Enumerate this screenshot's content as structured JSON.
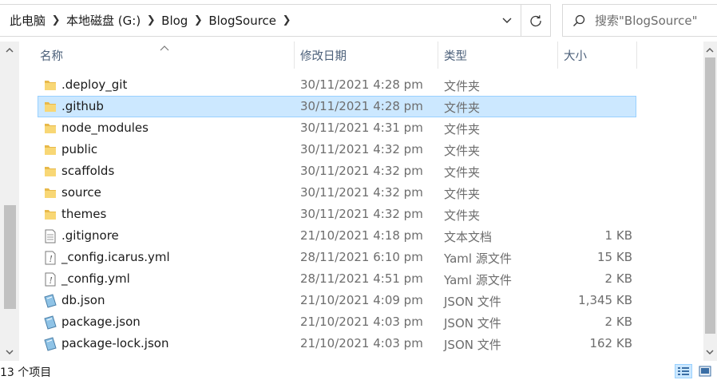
{
  "address_bar": {
    "crumbs": [
      "此电脑",
      "本地磁盘 (G:)",
      "Blog",
      "BlogSource"
    ]
  },
  "search": {
    "placeholder": "搜索\"BlogSource\""
  },
  "columns": {
    "name": "名称",
    "modified": "修改日期",
    "type": "类型",
    "size": "大小"
  },
  "files": [
    {
      "name": ".deploy_git",
      "date": "30/11/2021 4:28 pm",
      "type": "文件夹",
      "size": "",
      "icon": "folder-icon"
    },
    {
      "name": ".github",
      "date": "30/11/2021 4:28 pm",
      "type": "文件夹",
      "size": "",
      "icon": "folder-icon",
      "selected": true
    },
    {
      "name": "node_modules",
      "date": "30/11/2021 4:31 pm",
      "type": "文件夹",
      "size": "",
      "icon": "folder-icon"
    },
    {
      "name": "public",
      "date": "30/11/2021 4:32 pm",
      "type": "文件夹",
      "size": "",
      "icon": "folder-icon"
    },
    {
      "name": "scaffolds",
      "date": "30/11/2021 4:32 pm",
      "type": "文件夹",
      "size": "",
      "icon": "folder-icon"
    },
    {
      "name": "source",
      "date": "30/11/2021 4:32 pm",
      "type": "文件夹",
      "size": "",
      "icon": "folder-icon"
    },
    {
      "name": "themes",
      "date": "30/11/2021 4:32 pm",
      "type": "文件夹",
      "size": "",
      "icon": "folder-icon"
    },
    {
      "name": ".gitignore",
      "date": "21/10/2021 4:18 pm",
      "type": "文本文档",
      "size": "1 KB",
      "icon": "text-file-icon"
    },
    {
      "name": "_config.icarus.yml",
      "date": "28/11/2021 6:10 pm",
      "type": "Yaml 源文件",
      "size": "15 KB",
      "icon": "yaml-file-icon"
    },
    {
      "name": "_config.yml",
      "date": "28/11/2021 4:51 pm",
      "type": "Yaml 源文件",
      "size": "2 KB",
      "icon": "yaml-file-icon"
    },
    {
      "name": "db.json",
      "date": "21/10/2021 4:09 pm",
      "type": "JSON 文件",
      "size": "1,345 KB",
      "icon": "json-file-icon"
    },
    {
      "name": "package.json",
      "date": "21/10/2021 4:03 pm",
      "type": "JSON 文件",
      "size": "2 KB",
      "icon": "json-file-icon"
    },
    {
      "name": "package-lock.json",
      "date": "21/10/2021 4:03 pm",
      "type": "JSON 文件",
      "size": "162 KB",
      "icon": "json-file-icon"
    }
  ],
  "status_bar": {
    "count": "13 个项目"
  },
  "colors": {
    "selection": "#cce8ff",
    "selection_border": "#99d1ff",
    "folder": "#f8d775",
    "header_text": "#4c607a"
  }
}
